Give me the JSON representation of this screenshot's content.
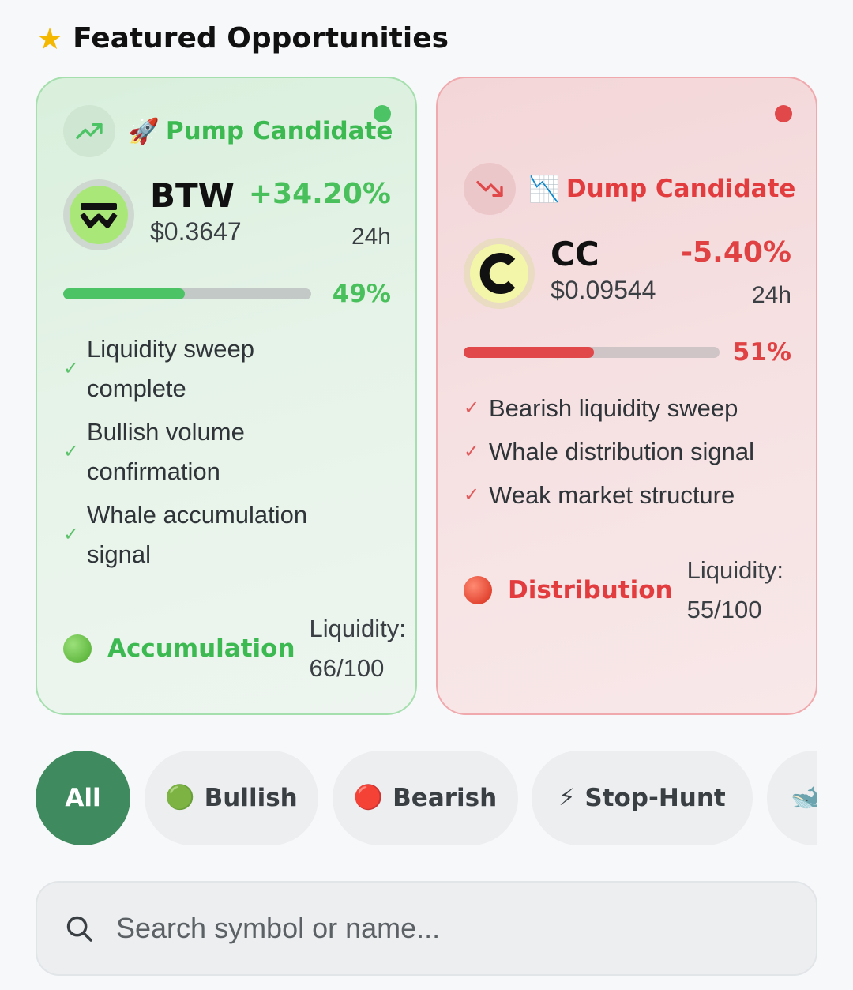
{
  "section": {
    "title": "Featured Opportunities",
    "icon": "star-icon"
  },
  "cards": {
    "pump": {
      "candidate_label": "Pump Candidate",
      "trend_icon": "trend-up-icon",
      "candidate_emoji": "🚀",
      "symbol": "BTW",
      "price": "$0.3647",
      "change": "+34.20%",
      "period": "24h",
      "progress_label": "49%",
      "progress_value": 0.49,
      "signals": [
        "Liquidity sweep complete",
        "Bullish volume confirmation",
        "Whale accumulation signal"
      ],
      "phase_label": "Accumulation",
      "liquidity_label": "Liquidity:",
      "liquidity_value": "66/100",
      "accent": "#49c05b"
    },
    "dump": {
      "candidate_label": "Dump Candidate",
      "trend_icon": "trend-down-icon",
      "candidate_emoji": "📉",
      "symbol": "CC",
      "price": "$0.09544",
      "change": "-5.40%",
      "period": "24h",
      "progress_label": "51%",
      "progress_value": 0.51,
      "signals": [
        "Bearish liquidity sweep",
        "Whale distribution signal",
        "Weak market structure"
      ],
      "phase_label": "Distribution",
      "liquidity_label": "Liquidity:",
      "liquidity_value": "55/100",
      "accent": "#e04244"
    }
  },
  "filters": [
    {
      "label": "All",
      "emoji": "",
      "active": true
    },
    {
      "label": "Bullish",
      "emoji": "🟢",
      "active": false
    },
    {
      "label": "Bearish",
      "emoji": "🔴",
      "active": false
    },
    {
      "label": "Stop-Hunt",
      "emoji": "⚡",
      "active": false
    },
    {
      "label": "",
      "emoji": "🐋",
      "active": false
    }
  ],
  "search": {
    "placeholder": "Search symbol or name...",
    "value": ""
  }
}
